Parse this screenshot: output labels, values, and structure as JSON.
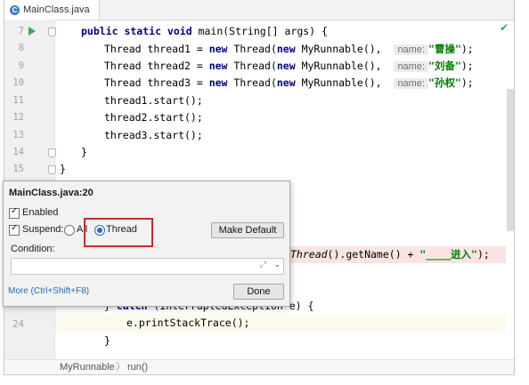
{
  "tab": {
    "icon": "class-c-icon",
    "label": "MainClass.java"
  },
  "gutter_lines": [
    {
      "n": "7"
    },
    {
      "n": "8"
    },
    {
      "n": "9"
    },
    {
      "n": "10"
    },
    {
      "n": "11"
    },
    {
      "n": "12"
    },
    {
      "n": "13"
    },
    {
      "n": "14"
    },
    {
      "n": "15"
    },
    {
      "n": "24"
    }
  ],
  "code": {
    "l7_kw": "public static void",
    "l7_rest": " main(String[] args) {",
    "l8_a": "Thread thread1 = ",
    "l8_new1": "new",
    "l8_b": " Thread(",
    "l8_new2": "new",
    "l8_c": " MyRunnable(),  ",
    "l8_hint": "name:",
    "l8_str": "\"曹操\"",
    "l8_end": ");",
    "l9_a": "Thread thread2 = ",
    "l9_new1": "new",
    "l9_b": " Thread(",
    "l9_new2": "new",
    "l9_c": " MyRunnable(),  ",
    "l9_hint": "name:",
    "l9_str": "\"刘备\"",
    "l9_end": ");",
    "l10_a": "Thread thread3 = ",
    "l10_new1": "new",
    "l10_b": " Thread(",
    "l10_new2": "new",
    "l10_c": " MyRunnable(),  ",
    "l10_hint": "name:",
    "l10_str": "\"孙权\"",
    "l10_end": ");",
    "l11": "thread1.start();",
    "l12": "thread2.start();",
    "l13": "thread3.start();",
    "l14": "}",
    "l15": "}",
    "l20_ital": "Thread",
    "l20_rest": "().getName() + ",
    "l20_str": "\"____进入\"",
    "l20_end": ");",
    "l23_a": "} ",
    "l23_kw": "catch",
    "l23_rest": " (InterruptedException e) {",
    "l24": "e.printStackTrace();",
    "l25": "}"
  },
  "popup": {
    "title": "MainClass.java:20",
    "enabled_label": "Enabled",
    "suspend_label": "Suspend:",
    "all_label": "All",
    "thread_label": "Thread",
    "make_default": "Make Default",
    "condition_label": "Condition:",
    "more_link": "More (Ctrl+Shift+F8)",
    "done": "Done",
    "expand_icon": "expand-arrows-icon",
    "dropdown_icon": "chevron-down-icon"
  },
  "breadcrumb": {
    "class_name": "MyRunnable",
    "method": "run()"
  },
  "colors": {
    "keyword": "#000080",
    "string": "#008000",
    "accent": "#2a68c8",
    "highlight_box": "#cc2a2a"
  }
}
